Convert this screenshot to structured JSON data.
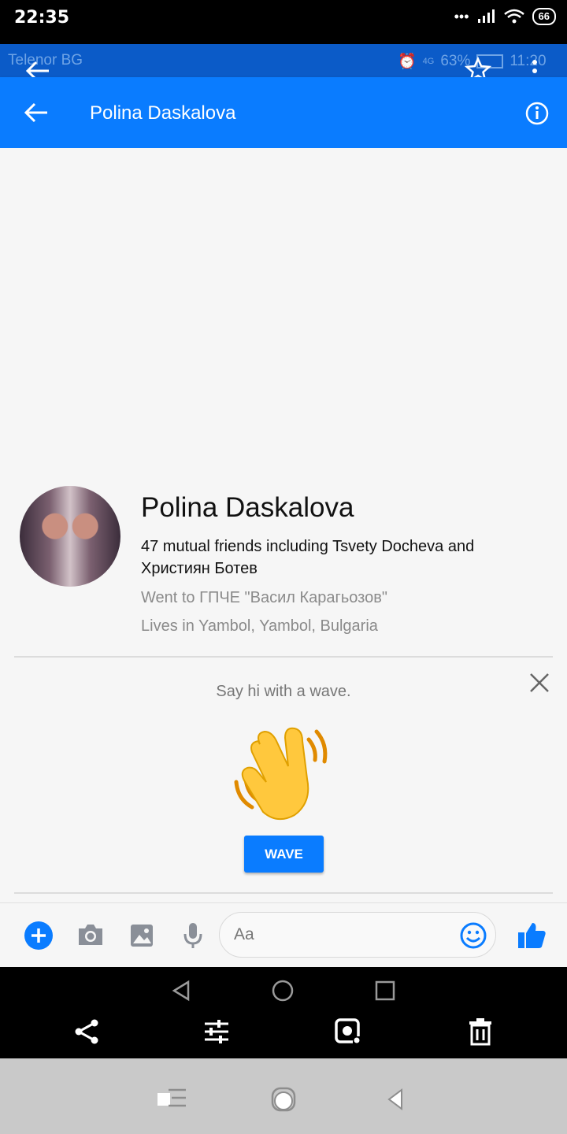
{
  "device_status": {
    "time": "22:35",
    "battery": "66"
  },
  "inner_status": {
    "carrier": "Telenor BG",
    "battery": "63%",
    "time": "11:20",
    "network": "4G"
  },
  "header": {
    "title": "Polina Daskalova"
  },
  "profile": {
    "name": "Polina Daskalova",
    "mutual": "47 mutual friends including Tsvety Docheva and Християн Ботев",
    "education": "Went to ГПЧЕ \"Васил Карагьозов\"",
    "location": "Lives in Yambol, Yambol, Bulgaria"
  },
  "wave": {
    "prompt": "Say hi with a wave.",
    "button": "WAVE"
  },
  "composer": {
    "placeholder": "Aa"
  },
  "colors": {
    "brand": "#0a7cff",
    "viewer_bar": "#0b5bc8"
  }
}
